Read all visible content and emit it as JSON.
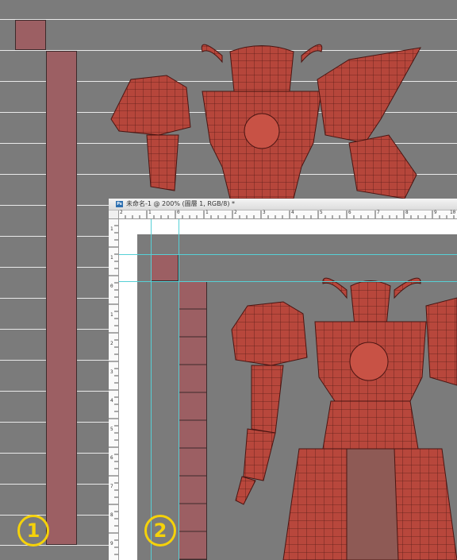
{
  "colors": {
    "background": "#7b7b7b",
    "guide_line": "#e9e9e9",
    "cell_fill": "#9c5f63",
    "cell_border": "#3c2a2b",
    "badge": "#f5d20a",
    "ps_guide": "#56d0d6",
    "robot": "#b8473c"
  },
  "badges": {
    "one": "1",
    "two": "2"
  },
  "photoshop_window": {
    "app_icon": "Ps",
    "title": "未命名-1 @ 200% (圖層 1, RGB/8) *",
    "ruler_top_labels": [
      "2",
      "1",
      "0",
      "1",
      "2",
      "3",
      "4",
      "5",
      "6",
      "7",
      "8",
      "9",
      "10"
    ],
    "ruler_left_labels": [
      "1",
      "1",
      "0",
      "1",
      "2",
      "3",
      "4",
      "5",
      "6",
      "7",
      "8",
      "9"
    ]
  },
  "icons": {
    "robot_model": "mecha-robot-wireframe"
  }
}
